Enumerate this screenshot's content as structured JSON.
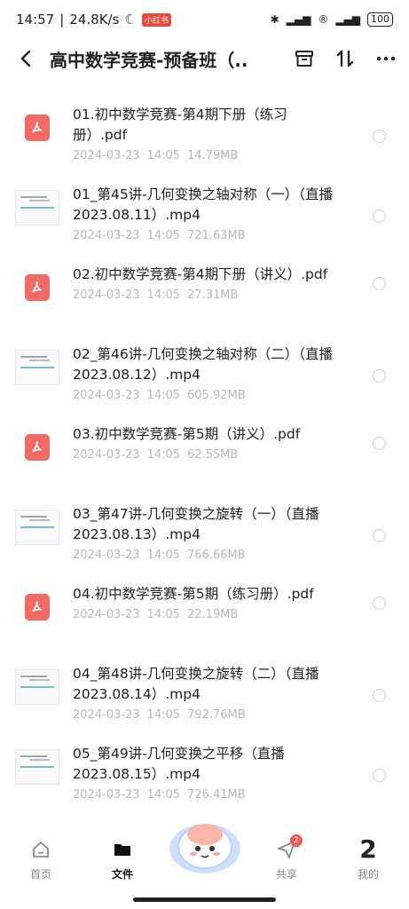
{
  "status": {
    "time": "14:57",
    "speed": "24.8K/s",
    "badge": "小红书",
    "battery": "100"
  },
  "header": {
    "title": "高中数学竞赛-预备班（..."
  },
  "files": [
    {
      "name": "01.初中数学竞赛-第4期下册（练习册）.pdf",
      "date": "2024-03-23",
      "time": "14:05",
      "size": "14.79MB",
      "type": "pdf"
    },
    {
      "name": "01_第45讲-几何变换之轴对称（一）（直播2023.08.11）.mp4",
      "date": "2024-03-23",
      "time": "14:05",
      "size": "721.63MB",
      "type": "video"
    },
    {
      "name": "02.初中数学竞赛-第4期下册（讲义）.pdf",
      "date": "2024-03-23",
      "time": "14:05",
      "size": "27.31MB",
      "type": "pdf"
    },
    {
      "name": "02_第46讲-几何变换之轴对称（二）（直播2023.08.12）.mp4",
      "date": "2024-03-23",
      "time": "14:05",
      "size": "605.92MB",
      "type": "video"
    },
    {
      "name": "03.初中数学竞赛-第5期（讲义）.pdf",
      "date": "2024-03-23",
      "time": "14:05",
      "size": "62.55MB",
      "type": "pdf"
    },
    {
      "name": "03_第47讲-几何变换之旋转（一）（直播2023.08.13）.mp4",
      "date": "2024-03-23",
      "time": "14:05",
      "size": "766.66MB",
      "type": "video"
    },
    {
      "name": "04.初中数学竞赛-第5期（练习册）.pdf",
      "date": "2024-03-23",
      "time": "14:05",
      "size": "22.19MB",
      "type": "pdf"
    },
    {
      "name": "04_第48讲-几何变换之旋转（二）（直播2023.08.14）.mp4",
      "date": "2024-03-23",
      "time": "14:05",
      "size": "792.76MB",
      "type": "video"
    },
    {
      "name": "05_第49讲-几何变换之平移（直播2023.08.15）.mp4",
      "date": "2024-03-23",
      "time": "14:05",
      "size": "726.41MB",
      "type": "video"
    }
  ],
  "tabs": {
    "home": "首页",
    "files": "文件",
    "share": "共享",
    "share_badge": "2",
    "mine": "我的",
    "mine_glyph": "2"
  },
  "colors": {
    "pdf": "#f26a63",
    "meta": "#b8b8b8",
    "badge": "#f25a5a"
  }
}
